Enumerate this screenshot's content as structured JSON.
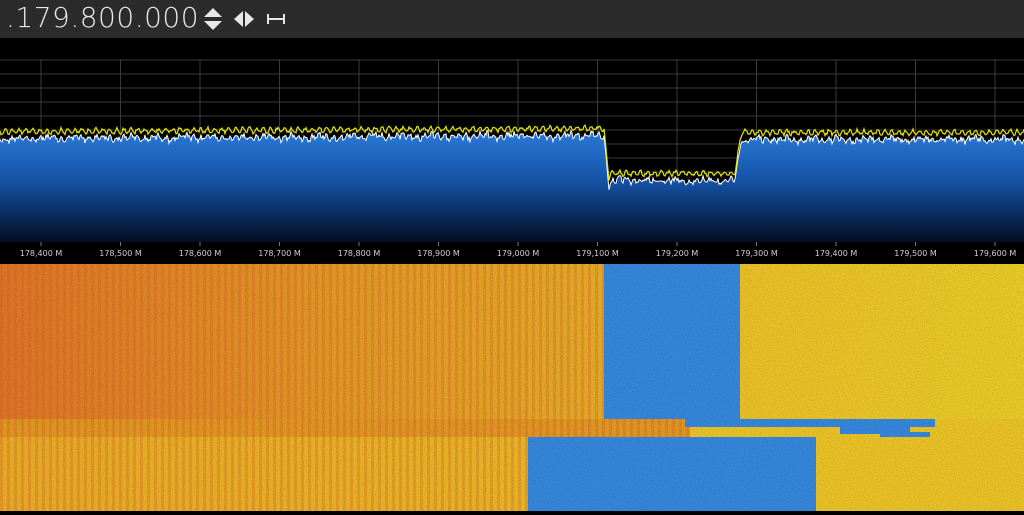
{
  "toolbar": {
    "frequency": ".179.800.000",
    "tune_icon": "up-down-arrows-icon",
    "step_icon": "left-right-arrows-icon",
    "span_icon": "span-range-icon"
  },
  "axis": {
    "ticks": [
      "178,400 M",
      "178,500 M",
      "178,600 M",
      "178,700 M",
      "178,800 M",
      "178,900 M",
      "179,000 M",
      "179,100 M",
      "179,200 M",
      "179,300 M",
      "179,400 M",
      "179,500 M",
      "179,600 M"
    ]
  },
  "colors": {
    "peak_trace": "#e6e600",
    "live_trace": "#ffffff",
    "spectrum_top": "#1f6fd0",
    "spectrum_bottom": "#05132e",
    "waterfall_hot": "#ffd21a",
    "waterfall_warm": "#ff8c1a",
    "waterfall_cold": "#2f8dff"
  }
}
